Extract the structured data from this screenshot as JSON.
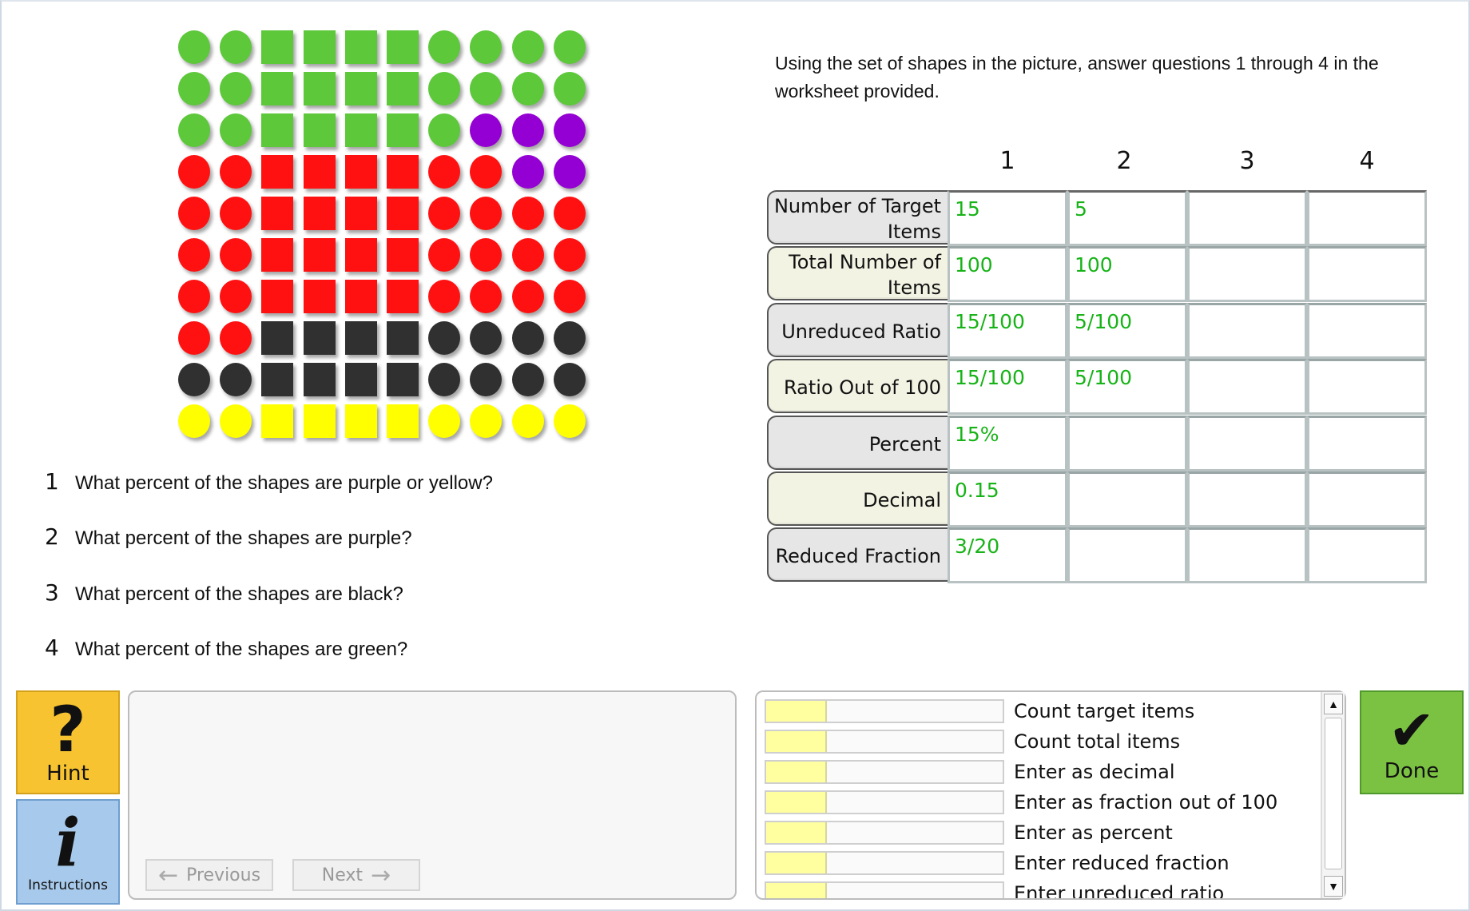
{
  "colors": {
    "green": "#5cc83a",
    "purple": "#9400d3",
    "red": "#ff1111",
    "black": "#303030",
    "yellow": "#ffff00",
    "answer_text": "#18b318",
    "hint_button": "#f7c331",
    "instructions_button": "#a7c9eb",
    "done_button": "#7cc242",
    "step_fill": "#ffffa0"
  },
  "shapes": {
    "column_kinds": [
      "circle",
      "circle",
      "square",
      "square",
      "square",
      "square",
      "circle",
      "circle",
      "circle",
      "circle"
    ],
    "rows": [
      [
        "green",
        "green",
        "green",
        "green",
        "green",
        "green",
        "green",
        "green",
        "green",
        "green"
      ],
      [
        "green",
        "green",
        "green",
        "green",
        "green",
        "green",
        "green",
        "green",
        "green",
        "green"
      ],
      [
        "green",
        "green",
        "green",
        "green",
        "green",
        "green",
        "green",
        "purple",
        "purple",
        "purple"
      ],
      [
        "red",
        "red",
        "red",
        "red",
        "red",
        "red",
        "red",
        "red",
        "purple",
        "purple"
      ],
      [
        "red",
        "red",
        "red",
        "red",
        "red",
        "red",
        "red",
        "red",
        "red",
        "red"
      ],
      [
        "red",
        "red",
        "red",
        "red",
        "red",
        "red",
        "red",
        "red",
        "red",
        "red"
      ],
      [
        "red",
        "red",
        "red",
        "red",
        "red",
        "red",
        "red",
        "red",
        "red",
        "red"
      ],
      [
        "red",
        "red",
        "black",
        "black",
        "black",
        "black",
        "black",
        "black",
        "black",
        "black"
      ],
      [
        "black",
        "black",
        "black",
        "black",
        "black",
        "black",
        "black",
        "black",
        "black",
        "black"
      ],
      [
        "yellow",
        "yellow",
        "yellow",
        "yellow",
        "yellow",
        "yellow",
        "yellow",
        "yellow",
        "yellow",
        "yellow"
      ]
    ]
  },
  "instruction": "Using the set of shapes in the picture, answer questions 1 through 4 in the worksheet provided.",
  "questions": [
    {
      "num": "1",
      "text": "What percent of the shapes are purple or yellow?"
    },
    {
      "num": "2",
      "text": "What percent of the shapes are purple?"
    },
    {
      "num": "3",
      "text": "What percent of the shapes are black?"
    },
    {
      "num": "4",
      "text": "What percent of the shapes are green?"
    }
  ],
  "worksheet": {
    "columns": [
      "1",
      "2",
      "3",
      "4"
    ],
    "rows": [
      {
        "label": "Number of Target Items",
        "label_lines": [
          "Number of Target",
          "Items"
        ],
        "values": [
          "15",
          "5",
          "",
          ""
        ]
      },
      {
        "label": "Total Number of Items",
        "label_lines": [
          "Total Number of",
          "Items"
        ],
        "values": [
          "100",
          "100",
          "",
          ""
        ]
      },
      {
        "label": "Unreduced Ratio",
        "label_lines": [
          "Unreduced Ratio"
        ],
        "values": [
          "15/100",
          "5/100",
          "",
          ""
        ]
      },
      {
        "label": "Ratio Out of 100",
        "label_lines": [
          "Ratio Out of 100"
        ],
        "values": [
          "15/100",
          "5/100",
          "",
          ""
        ]
      },
      {
        "label": "Percent",
        "label_lines": [
          "Percent"
        ],
        "values": [
          "15%",
          "",
          "",
          ""
        ]
      },
      {
        "label": "Decimal",
        "label_lines": [
          "Decimal"
        ],
        "values": [
          "0.15",
          "",
          "",
          ""
        ]
      },
      {
        "label": "Reduced Fraction",
        "label_lines": [
          "Reduced Fraction"
        ],
        "values": [
          "3/20",
          "",
          "",
          ""
        ]
      }
    ]
  },
  "buttons": {
    "hint_symbol": "?",
    "hint": "Hint",
    "instructions_symbol": "i",
    "instructions": "Instructions",
    "previous": "Previous",
    "next": "Next",
    "done_symbol": "✔",
    "done": "Done"
  },
  "steps": [
    {
      "label": "Count target items"
    },
    {
      "label": "Count total items"
    },
    {
      "label": "Enter as decimal"
    },
    {
      "label": "Enter as fraction out of 100"
    },
    {
      "label": "Enter as percent"
    },
    {
      "label": "Enter reduced fraction"
    },
    {
      "label": "Enter unreduced ratio"
    }
  ]
}
